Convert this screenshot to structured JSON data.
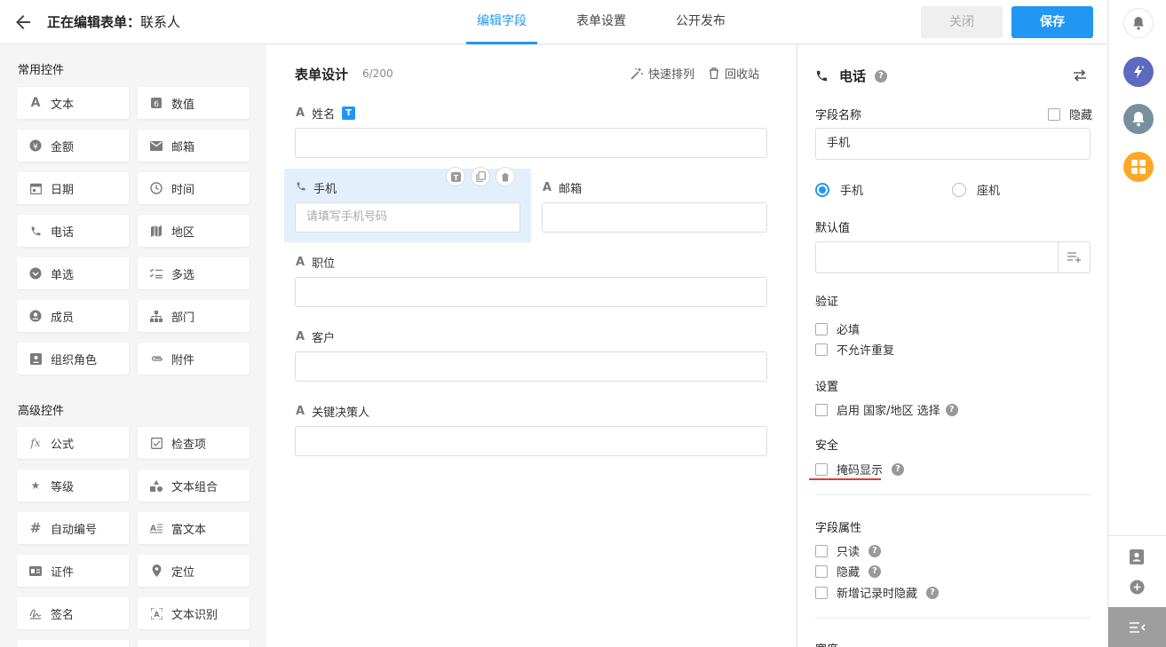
{
  "header": {
    "title_prefix": "正在编辑表单：",
    "title_name": "联系人",
    "tabs": [
      {
        "label": "编辑字段",
        "active": true
      },
      {
        "label": "表单设置",
        "active": false
      },
      {
        "label": "公开发布",
        "active": false
      }
    ],
    "close_label": "关闭",
    "save_label": "保存"
  },
  "left": {
    "common_title": "常用控件",
    "common": [
      {
        "label": "文本",
        "icon": "text-icon"
      },
      {
        "label": "数值",
        "icon": "number-icon"
      },
      {
        "label": "金额",
        "icon": "currency-icon"
      },
      {
        "label": "邮箱",
        "icon": "mail-icon"
      },
      {
        "label": "日期",
        "icon": "calendar-icon"
      },
      {
        "label": "时间",
        "icon": "clock-icon"
      },
      {
        "label": "电话",
        "icon": "phone-icon"
      },
      {
        "label": "地区",
        "icon": "map-icon"
      },
      {
        "label": "单选",
        "icon": "radio-icon"
      },
      {
        "label": "多选",
        "icon": "checklist-icon"
      },
      {
        "label": "成员",
        "icon": "user-icon"
      },
      {
        "label": "部门",
        "icon": "org-icon"
      },
      {
        "label": "组织角色",
        "icon": "role-icon"
      },
      {
        "label": "附件",
        "icon": "attachment-icon"
      }
    ],
    "advanced_title": "高级控件",
    "advanced": [
      {
        "label": "公式",
        "icon": "formula-icon"
      },
      {
        "label": "检查项",
        "icon": "check-icon"
      },
      {
        "label": "等级",
        "icon": "star-icon"
      },
      {
        "label": "文本组合",
        "icon": "shapes-icon"
      },
      {
        "label": "自动编号",
        "icon": "hash-icon"
      },
      {
        "label": "富文本",
        "icon": "richtext-icon"
      },
      {
        "label": "证件",
        "icon": "id-card-icon"
      },
      {
        "label": "定位",
        "icon": "location-icon"
      },
      {
        "label": "签名",
        "icon": "signature-icon"
      },
      {
        "label": "文本识别",
        "icon": "ocr-icon"
      }
    ]
  },
  "design": {
    "title": "表单设计",
    "count": "6/200",
    "quick_sort": "快速排列",
    "recycle": "回收站",
    "fields": {
      "name": "姓名",
      "name_badge": "T",
      "phone": "手机",
      "phone_placeholder": "请填写手机号码",
      "email": "邮箱",
      "position": "职位",
      "customer": "客户",
      "decision_maker": "关键决策人"
    },
    "mini_t": "T"
  },
  "props": {
    "title": "电话",
    "field_name_label": "字段名称",
    "hidden_label": "隐藏",
    "field_name_value": "手机",
    "radio_mobile": "手机",
    "radio_landline": "座机",
    "default_label": "默认值",
    "validation_label": "验证",
    "required": "必填",
    "no_duplicate": "不允许重复",
    "settings_label": "设置",
    "enable_country": "启用 国家/地区 选择",
    "security_label": "安全",
    "mask_display": "掩码显示",
    "attr_label": "字段属性",
    "readonly": "只读",
    "hidden": "隐藏",
    "hide_on_new": "新增记录时隐藏",
    "width_label": "宽度"
  },
  "colors": {
    "accent": "#2196f3",
    "sidebar_purple": "#5c6bc0",
    "sidebar_gray": "#78909c",
    "sidebar_orange": "#ffa726",
    "underline_red": "#e53935"
  }
}
